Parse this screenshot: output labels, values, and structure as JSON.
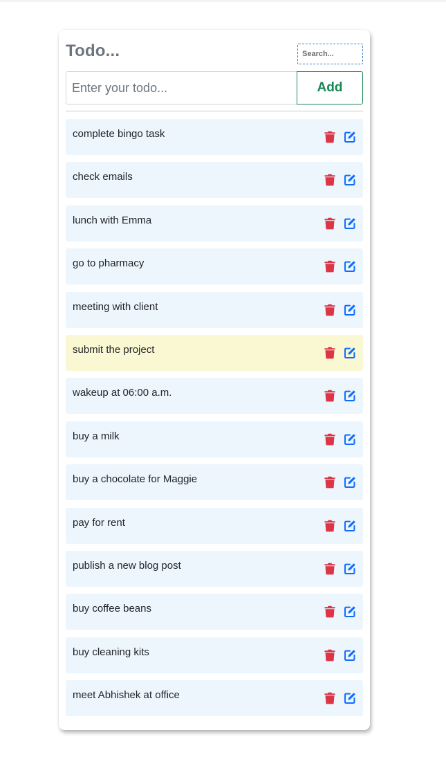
{
  "app": {
    "title": "Todo...",
    "search_placeholder": "Search...",
    "input_placeholder": "Enter your todo...",
    "add_label": "Add"
  },
  "colors": {
    "delete": "#dc3545",
    "edit": "#0d6efd",
    "accent": "#198754",
    "item_bg": "#edf5fd",
    "highlight_bg": "#f9f8d2"
  },
  "todos": [
    {
      "text": "complete bingo task",
      "highlighted": false
    },
    {
      "text": "check emails",
      "highlighted": false
    },
    {
      "text": "lunch with Emma",
      "highlighted": false
    },
    {
      "text": "go to pharmacy",
      "highlighted": false
    },
    {
      "text": "meeting with client",
      "highlighted": false
    },
    {
      "text": "submit the project",
      "highlighted": true
    },
    {
      "text": "wakeup at 06:00 a.m.",
      "highlighted": false
    },
    {
      "text": "buy a milk",
      "highlighted": false
    },
    {
      "text": "buy a chocolate for Maggie",
      "highlighted": false
    },
    {
      "text": "pay for rent",
      "highlighted": false
    },
    {
      "text": "publish a new blog post",
      "highlighted": false
    },
    {
      "text": "buy coffee beans",
      "highlighted": false
    },
    {
      "text": "buy cleaning kits",
      "highlighted": false
    },
    {
      "text": "meet Abhishek at office",
      "highlighted": false
    }
  ],
  "icons": {
    "delete": "trash-icon",
    "edit": "edit-icon"
  }
}
